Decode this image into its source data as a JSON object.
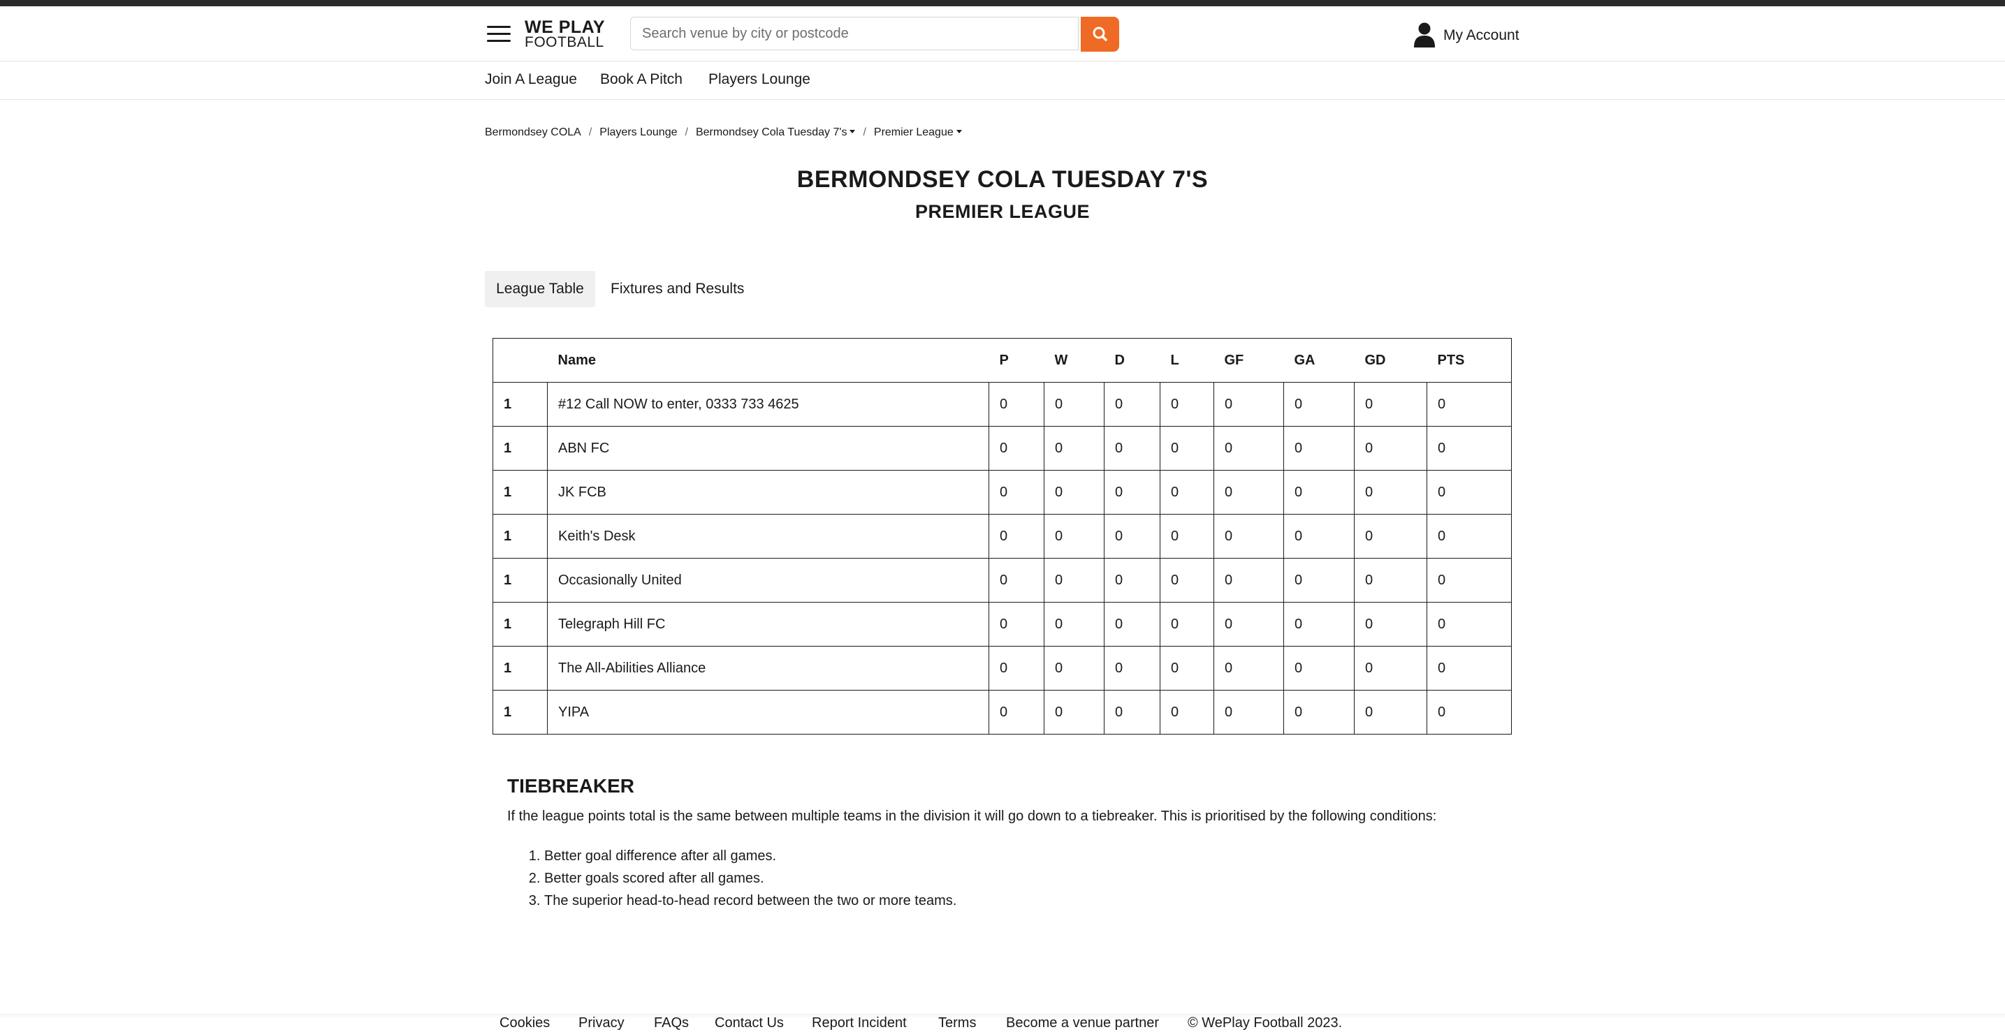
{
  "header": {
    "logo_line1": "WE PLAY",
    "logo_line2": "FOOTBALL",
    "search_placeholder": "Search venue by city or postcode",
    "account_label": "My Account"
  },
  "subnav": [
    "Join A League",
    "Book A Pitch",
    "Players Lounge"
  ],
  "breadcrumb": [
    "Bermondsey COLA",
    "Players Lounge",
    "Bermondsey Cola Tuesday 7's",
    "Premier League"
  ],
  "page": {
    "title": "BERMONDSEY COLA TUESDAY 7'S",
    "subtitle": "PREMIER LEAGUE"
  },
  "tabs": [
    "League Table",
    "Fixtures and Results"
  ],
  "table": {
    "headers": [
      "",
      "Name",
      "P",
      "W",
      "D",
      "L",
      "GF",
      "GA",
      "GD",
      "PTS"
    ],
    "rows": [
      [
        "1",
        "#12 Call NOW to enter, 0333 733 4625",
        "0",
        "0",
        "0",
        "0",
        "0",
        "0",
        "0",
        "0"
      ],
      [
        "1",
        "ABN FC",
        "0",
        "0",
        "0",
        "0",
        "0",
        "0",
        "0",
        "0"
      ],
      [
        "1",
        "JK FCB",
        "0",
        "0",
        "0",
        "0",
        "0",
        "0",
        "0",
        "0"
      ],
      [
        "1",
        "Keith's Desk",
        "0",
        "0",
        "0",
        "0",
        "0",
        "0",
        "0",
        "0"
      ],
      [
        "1",
        "Occasionally United",
        "0",
        "0",
        "0",
        "0",
        "0",
        "0",
        "0",
        "0"
      ],
      [
        "1",
        "Telegraph Hill FC",
        "0",
        "0",
        "0",
        "0",
        "0",
        "0",
        "0",
        "0"
      ],
      [
        "1",
        "The All-Abilities Alliance",
        "0",
        "0",
        "0",
        "0",
        "0",
        "0",
        "0",
        "0"
      ],
      [
        "1",
        "YIPA",
        "0",
        "0",
        "0",
        "0",
        "0",
        "0",
        "0",
        "0"
      ]
    ]
  },
  "tiebreaker": {
    "title": "TIEBREAKER",
    "text": "If the league points total is the same between multiple teams in the division it will go down to a tiebreaker. This is prioritised by the following conditions:",
    "items": [
      "Better goal difference after all games.",
      "Better goals scored after all games.",
      "The superior head-to-head record between the two or more teams."
    ]
  },
  "footer": {
    "links": [
      "Cookies",
      "Privacy",
      "FAQs",
      "Contact Us",
      "Report Incident",
      "Terms",
      "Become a venue partner"
    ],
    "copyright": "© WePlay Football 2023."
  },
  "colors": {
    "accent": "#ef6a24",
    "topbar": "#2b2b2b",
    "text": "#1a1a1a"
  },
  "icons": [
    "menu-icon",
    "search-icon",
    "person-icon",
    "caret-down-icon"
  ]
}
